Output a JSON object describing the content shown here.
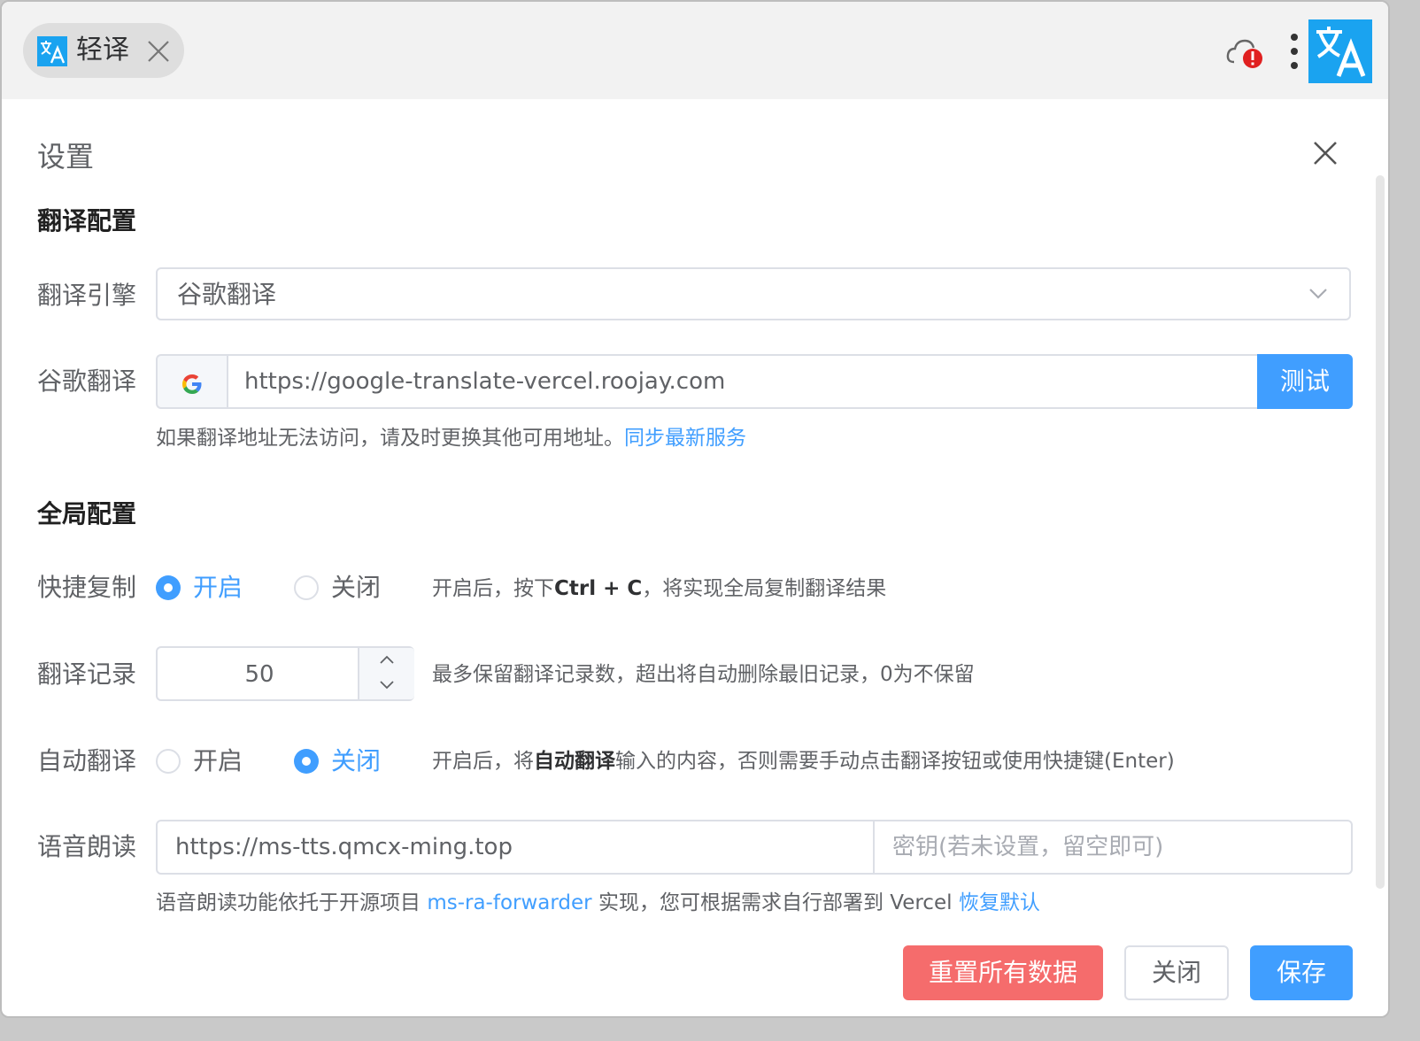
{
  "app": {
    "tab_title": "轻译",
    "logo_icon": "translate-icon",
    "brand_color": "#1aa3f0",
    "alert_color": "#e02020"
  },
  "dialog": {
    "title": "设置"
  },
  "translate_section": {
    "title": "翻译配置",
    "engine": {
      "label": "翻译引擎",
      "value": "谷歌翻译"
    },
    "google": {
      "label": "谷歌翻译",
      "icon": "google-icon",
      "url": "https://google-translate-vercel.roojay.com",
      "test_button": "测试"
    },
    "hint_text": "如果翻译地址无法访问，请及时更换其他可用地址。",
    "hint_link": "同步最新服务"
  },
  "global_section": {
    "title": "全局配置",
    "quick_copy": {
      "label": "快捷复制",
      "on": "开启",
      "off": "关闭",
      "selected": "on",
      "desc_1": "开启后，按下",
      "desc_bold": "Ctrl + C",
      "desc_2": "，将实现全局复制翻译结果"
    },
    "history": {
      "label": "翻译记录",
      "value": "50",
      "desc": "最多保留翻译记录数，超出将自动删除最旧记录，0为不保留"
    },
    "auto_translate": {
      "label": "自动翻译",
      "on": "开启",
      "off": "关闭",
      "selected": "off",
      "desc_1": "开启后，将",
      "desc_bold": "自动翻译",
      "desc_2": "输入的内容，否则需要手动点击翻译按钮或使用快捷键(Enter)"
    },
    "tts": {
      "label": "语音朗读",
      "url": "https://ms-tts.qmcx-ming.top",
      "key_placeholder": "密钥(若未设置，留空即可)",
      "hint_1": "语音朗读功能依托于开源项目 ",
      "hint_link": "ms-ra-forwarder",
      "hint_2": " 实现，您可根据需求自行部署到 Vercel ",
      "restore_link": "恢复默认"
    }
  },
  "footer": {
    "reset_button": "重置所有数据",
    "close_button": "关闭",
    "save_button": "保存"
  },
  "colors": {
    "primary": "#409eff",
    "danger": "#f56c6c",
    "text": "#606266"
  }
}
